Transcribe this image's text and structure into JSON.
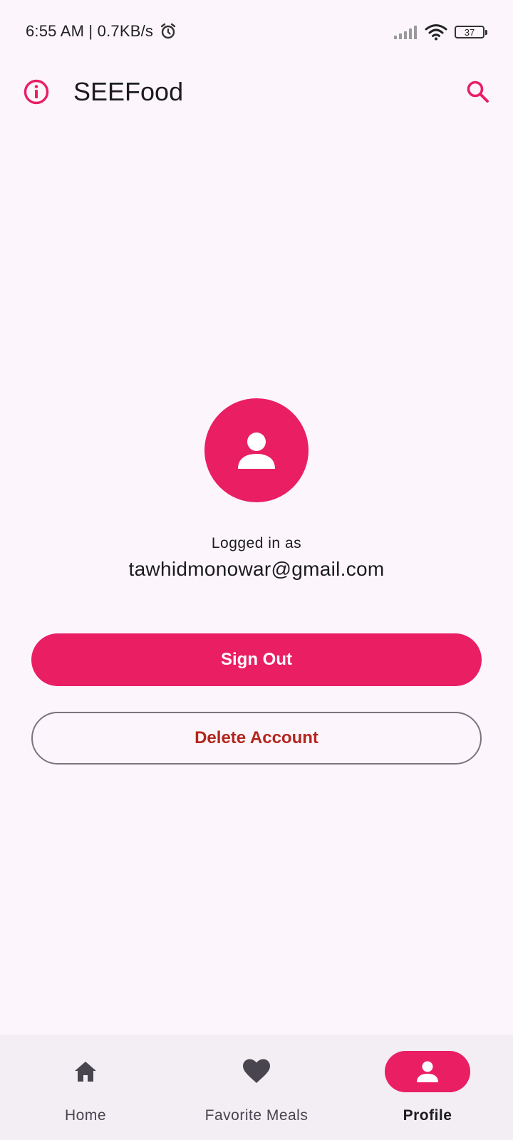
{
  "status_bar": {
    "time": "6:55 AM | 0.7KB/s",
    "battery": "37",
    "icons": [
      "alarm-icon",
      "signal-icon",
      "wifi-icon",
      "battery-icon"
    ]
  },
  "app_bar": {
    "title": "SEEFood",
    "left_icon": "info-icon",
    "right_icon": "search-icon"
  },
  "profile": {
    "avatar_icon": "person-icon",
    "logged_in_label": "Logged in as",
    "email": "tawhidmonowar@gmail.com",
    "sign_out_label": "Sign Out",
    "delete_account_label": "Delete Account"
  },
  "bottom_nav": {
    "items": [
      {
        "label": "Home",
        "icon": "home-icon",
        "active": false
      },
      {
        "label": "Favorite Meals",
        "icon": "heart-icon",
        "active": false
      },
      {
        "label": "Profile",
        "icon": "person-icon",
        "active": true
      }
    ]
  },
  "colors": {
    "accent": "#E91E63",
    "background": "#FCF6FC",
    "danger_text": "#B3261E",
    "nav_background": "#F3EDF4"
  }
}
